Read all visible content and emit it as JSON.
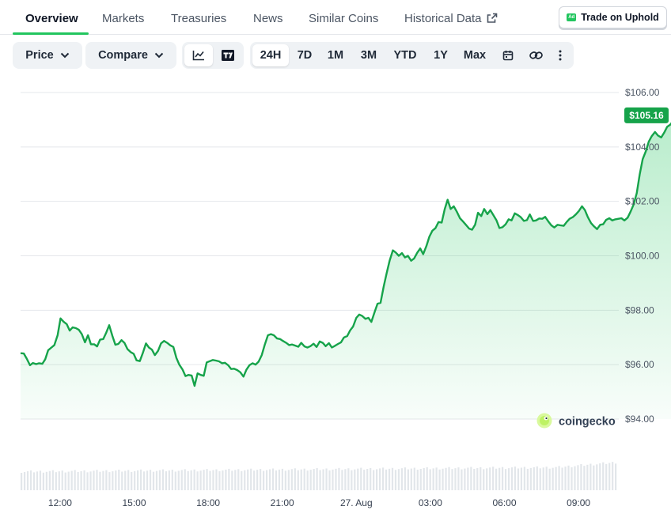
{
  "tabs": [
    {
      "label": "Overview",
      "active": true
    },
    {
      "label": "Markets"
    },
    {
      "label": "Treasuries"
    },
    {
      "label": "News"
    },
    {
      "label": "Similar Coins"
    },
    {
      "label": "Historical Data",
      "external": true
    }
  ],
  "trade_button": {
    "badge": "Ad",
    "label": "Trade on Uphold"
  },
  "toolbar": {
    "price_label": "Price",
    "compare_label": "Compare",
    "chart_modes": [
      {
        "icon": "line-chart-icon",
        "active": true
      },
      {
        "icon": "tradingview-icon"
      }
    ],
    "ranges": [
      {
        "label": "24H",
        "active": true
      },
      {
        "label": "7D"
      },
      {
        "label": "1M"
      },
      {
        "label": "3M"
      },
      {
        "label": "YTD"
      },
      {
        "label": "1Y"
      },
      {
        "label": "Max"
      }
    ],
    "icons": [
      "calendar-icon",
      "link-icon",
      "more-vertical-icon"
    ]
  },
  "chart_data": {
    "type": "area",
    "title": "",
    "y_ticks": [
      "$106.00",
      "$104.00",
      "$102.00",
      "$100.00",
      "$98.00",
      "$96.00",
      "$94.00"
    ],
    "ylim": [
      94,
      106
    ],
    "x_ticks": [
      "12:00",
      "15:00",
      "18:00",
      "21:00",
      "27. Aug",
      "03:00",
      "06:00",
      "09:00"
    ],
    "x_tick_hours": [
      12,
      15,
      18,
      21,
      24,
      27,
      30,
      33
    ],
    "xlim": [
      10.4,
      34.6
    ],
    "current_price_label": "$105.16",
    "current_price": 105.16,
    "line_color": "#16a34a",
    "watermark": "coingecko",
    "series": [
      {
        "values": [
          [
            10.4,
            96.42
          ],
          [
            10.53,
            96.41
          ],
          [
            10.65,
            96.22
          ],
          [
            10.78,
            95.98
          ],
          [
            10.9,
            96.06
          ],
          [
            11.03,
            96.02
          ],
          [
            11.15,
            96.05
          ],
          [
            11.28,
            96.03
          ],
          [
            11.4,
            96.2
          ],
          [
            11.52,
            96.53
          ],
          [
            11.65,
            96.63
          ],
          [
            11.77,
            96.72
          ],
          [
            11.9,
            97.08
          ],
          [
            12.02,
            97.7
          ],
          [
            12.14,
            97.58
          ],
          [
            12.27,
            97.49
          ],
          [
            12.39,
            97.25
          ],
          [
            12.51,
            97.37
          ],
          [
            12.64,
            97.34
          ],
          [
            12.76,
            97.28
          ],
          [
            12.88,
            97.12
          ],
          [
            13.01,
            96.82
          ],
          [
            13.13,
            97.08
          ],
          [
            13.25,
            96.75
          ],
          [
            13.38,
            96.75
          ],
          [
            13.5,
            96.67
          ],
          [
            13.62,
            96.92
          ],
          [
            13.75,
            96.94
          ],
          [
            13.87,
            97.18
          ],
          [
            13.99,
            97.45
          ],
          [
            14.12,
            97.05
          ],
          [
            14.24,
            96.73
          ],
          [
            14.36,
            96.76
          ],
          [
            14.49,
            96.9
          ],
          [
            14.61,
            96.8
          ],
          [
            14.73,
            96.57
          ],
          [
            14.86,
            96.46
          ],
          [
            14.98,
            96.4
          ],
          [
            15.1,
            96.16
          ],
          [
            15.23,
            96.13
          ],
          [
            15.35,
            96.42
          ],
          [
            15.48,
            96.78
          ],
          [
            15.6,
            96.63
          ],
          [
            15.72,
            96.55
          ],
          [
            15.84,
            96.35
          ],
          [
            15.97,
            96.51
          ],
          [
            16.09,
            96.78
          ],
          [
            16.21,
            96.87
          ],
          [
            16.34,
            96.8
          ],
          [
            16.46,
            96.71
          ],
          [
            16.59,
            96.65
          ],
          [
            16.71,
            96.25
          ],
          [
            16.83,
            96.0
          ],
          [
            16.96,
            95.82
          ],
          [
            17.08,
            95.58
          ],
          [
            17.2,
            95.62
          ],
          [
            17.33,
            95.6
          ],
          [
            17.45,
            95.22
          ],
          [
            17.57,
            95.68
          ],
          [
            17.7,
            95.62
          ],
          [
            17.82,
            95.59
          ],
          [
            17.94,
            96.08
          ],
          [
            18.07,
            96.13
          ],
          [
            18.19,
            96.17
          ],
          [
            18.31,
            96.15
          ],
          [
            18.44,
            96.12
          ],
          [
            18.56,
            96.05
          ],
          [
            18.68,
            96.07
          ],
          [
            18.81,
            95.98
          ],
          [
            18.93,
            95.84
          ],
          [
            19.05,
            95.85
          ],
          [
            19.18,
            95.8
          ],
          [
            19.3,
            95.72
          ],
          [
            19.43,
            95.56
          ],
          [
            19.55,
            95.82
          ],
          [
            19.67,
            95.98
          ],
          [
            19.8,
            96.05
          ],
          [
            19.92,
            96.0
          ],
          [
            20.04,
            96.11
          ],
          [
            20.17,
            96.35
          ],
          [
            20.29,
            96.73
          ],
          [
            20.42,
            97.08
          ],
          [
            20.54,
            97.12
          ],
          [
            20.66,
            97.08
          ],
          [
            20.79,
            96.96
          ],
          [
            20.91,
            96.94
          ],
          [
            21.03,
            96.87
          ],
          [
            21.16,
            96.8
          ],
          [
            21.28,
            96.72
          ],
          [
            21.4,
            96.74
          ],
          [
            21.53,
            96.7
          ],
          [
            21.65,
            96.66
          ],
          [
            21.77,
            96.8
          ],
          [
            21.9,
            96.67
          ],
          [
            22.02,
            96.63
          ],
          [
            22.14,
            96.68
          ],
          [
            22.27,
            96.77
          ],
          [
            22.39,
            96.65
          ],
          [
            22.52,
            96.85
          ],
          [
            22.64,
            96.8
          ],
          [
            22.76,
            96.68
          ],
          [
            22.89,
            96.79
          ],
          [
            23.01,
            96.63
          ],
          [
            23.13,
            96.69
          ],
          [
            23.26,
            96.76
          ],
          [
            23.38,
            96.82
          ],
          [
            23.5,
            97.0
          ],
          [
            23.63,
            97.05
          ],
          [
            23.75,
            97.26
          ],
          [
            23.87,
            97.4
          ],
          [
            24.0,
            97.72
          ],
          [
            24.12,
            97.84
          ],
          [
            24.24,
            97.79
          ],
          [
            24.37,
            97.68
          ],
          [
            24.49,
            97.72
          ],
          [
            24.61,
            97.57
          ],
          [
            24.74,
            97.93
          ],
          [
            24.86,
            98.24
          ],
          [
            24.98,
            98.27
          ],
          [
            25.11,
            98.87
          ],
          [
            25.23,
            99.37
          ],
          [
            25.35,
            99.82
          ],
          [
            25.48,
            100.2
          ],
          [
            25.6,
            100.12
          ],
          [
            25.72,
            100.0
          ],
          [
            25.85,
            100.1
          ],
          [
            25.97,
            99.94
          ],
          [
            26.09,
            100.0
          ],
          [
            26.22,
            99.82
          ],
          [
            26.34,
            99.9
          ],
          [
            26.47,
            100.12
          ],
          [
            26.59,
            100.27
          ],
          [
            26.71,
            100.06
          ],
          [
            26.84,
            100.36
          ],
          [
            26.96,
            100.7
          ],
          [
            27.08,
            100.92
          ],
          [
            27.21,
            101.02
          ],
          [
            27.33,
            101.24
          ],
          [
            27.46,
            101.22
          ],
          [
            27.58,
            101.71
          ],
          [
            27.7,
            102.06
          ],
          [
            27.82,
            101.72
          ],
          [
            27.95,
            101.82
          ],
          [
            28.07,
            101.62
          ],
          [
            28.2,
            101.38
          ],
          [
            28.32,
            101.26
          ],
          [
            28.44,
            101.14
          ],
          [
            28.57,
            101.0
          ],
          [
            28.69,
            100.96
          ],
          [
            28.81,
            101.14
          ],
          [
            28.93,
            101.58
          ],
          [
            29.06,
            101.46
          ],
          [
            29.18,
            101.72
          ],
          [
            29.31,
            101.53
          ],
          [
            29.43,
            101.68
          ],
          [
            29.55,
            101.5
          ],
          [
            29.68,
            101.3
          ],
          [
            29.8,
            101.02
          ],
          [
            29.92,
            101.05
          ],
          [
            30.05,
            101.16
          ],
          [
            30.17,
            101.34
          ],
          [
            30.29,
            101.3
          ],
          [
            30.42,
            101.56
          ],
          [
            30.54,
            101.5
          ],
          [
            30.66,
            101.42
          ],
          [
            30.79,
            101.28
          ],
          [
            30.91,
            101.31
          ],
          [
            31.03,
            101.52
          ],
          [
            31.16,
            101.28
          ],
          [
            31.28,
            101.3
          ],
          [
            31.41,
            101.37
          ],
          [
            31.53,
            101.36
          ],
          [
            31.65,
            101.43
          ],
          [
            31.78,
            101.26
          ],
          [
            31.9,
            101.12
          ],
          [
            32.02,
            101.04
          ],
          [
            32.15,
            101.14
          ],
          [
            32.27,
            101.12
          ],
          [
            32.4,
            101.1
          ],
          [
            32.52,
            101.24
          ],
          [
            32.64,
            101.36
          ],
          [
            32.77,
            101.42
          ],
          [
            32.89,
            101.52
          ],
          [
            33.01,
            101.64
          ],
          [
            33.14,
            101.82
          ],
          [
            33.26,
            101.68
          ],
          [
            33.38,
            101.42
          ],
          [
            33.51,
            101.2
          ],
          [
            33.63,
            101.08
          ],
          [
            33.75,
            100.98
          ],
          [
            33.88,
            101.14
          ],
          [
            34.0,
            101.16
          ],
          [
            34.12,
            101.32
          ],
          [
            34.25,
            101.38
          ],
          [
            34.37,
            101.3
          ],
          [
            34.49,
            101.34
          ],
          [
            34.62,
            101.36
          ],
          [
            34.74,
            101.38
          ],
          [
            34.86,
            101.3
          ],
          [
            34.99,
            101.4
          ],
          [
            35.11,
            101.62
          ],
          [
            35.23,
            101.88
          ],
          [
            35.36,
            102.3
          ],
          [
            35.48,
            103.0
          ],
          [
            35.6,
            103.55
          ],
          [
            35.73,
            103.85
          ],
          [
            35.85,
            104.2
          ],
          [
            35.97,
            104.4
          ],
          [
            36.1,
            104.55
          ],
          [
            36.22,
            104.42
          ],
          [
            36.35,
            104.35
          ],
          [
            36.47,
            104.52
          ],
          [
            36.59,
            104.74
          ],
          [
            36.72,
            104.82
          ],
          [
            36.84,
            104.96
          ],
          [
            36.96,
            105.16
          ]
        ]
      }
    ]
  }
}
